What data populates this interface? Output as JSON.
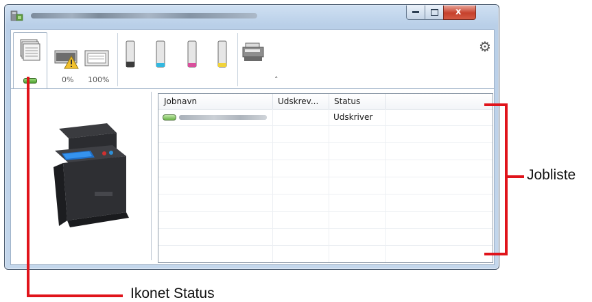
{
  "window": {
    "title": "",
    "controls": {
      "close_glyph": "x"
    }
  },
  "toolbar": {
    "tray_labels": [
      "0%",
      "100%"
    ],
    "icons": [
      "documents-stack-icon",
      "tray-warning-icon",
      "paper-tray-icon",
      "toner-black-icon",
      "toner-cyan-icon",
      "toner-magenta-icon",
      "toner-yellow-icon",
      "printer-mfp-icon",
      "gear-icon",
      "chevron-up-icon"
    ],
    "status_indicator_color": "#6db34a"
  },
  "joblist": {
    "columns": [
      "Jobnavn",
      "Udskrev...",
      "Status"
    ],
    "rows": [
      {
        "name": "",
        "printed": "",
        "status": "Udskriver"
      }
    ]
  },
  "annotations": {
    "joblist_label": "Jobliste",
    "icon_status_label": "Ikonet Status",
    "color": "#e0141b"
  }
}
